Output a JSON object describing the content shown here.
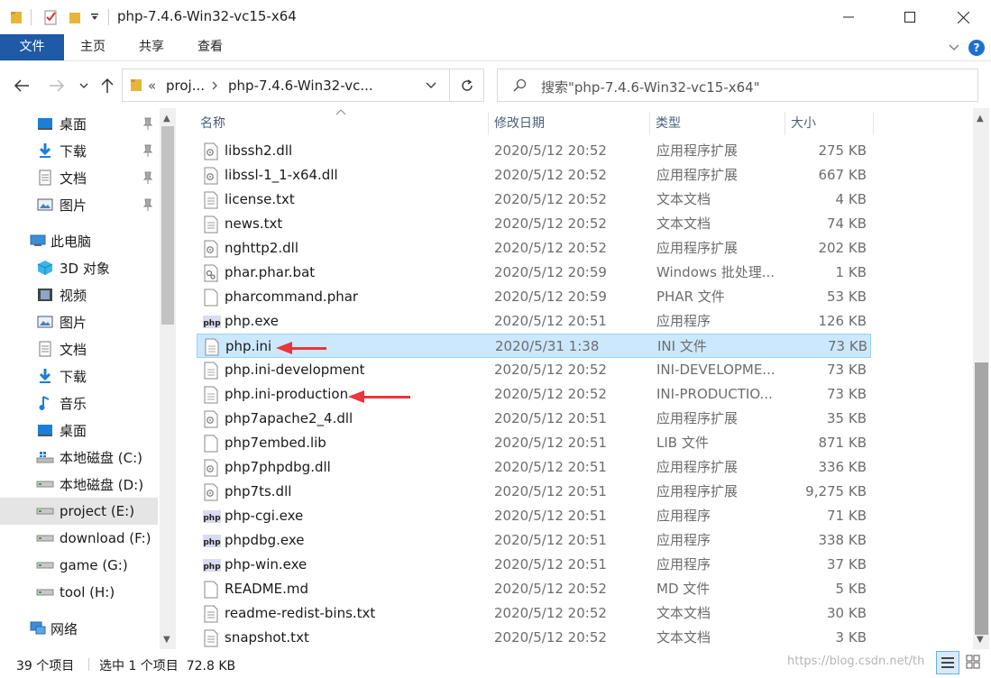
{
  "window": {
    "title": "php-7.4.6-Win32-vc15-x64"
  },
  "ribbon": {
    "tabs": [
      "文件",
      "主页",
      "共享",
      "查看"
    ]
  },
  "address": {
    "overflow": "«",
    "crumbs": [
      "proj...",
      "php-7.4.6-Win32-vc..."
    ]
  },
  "search": {
    "placeholder": "搜索\"php-7.4.6-Win32-vc15-x64\""
  },
  "sidebar": {
    "quick_access": [
      "桌面",
      "下载",
      "文档",
      "图片"
    ],
    "this_pc": "此电脑",
    "pc_items": [
      "3D 对象",
      "视频",
      "图片",
      "文档",
      "下载",
      "音乐",
      "桌面",
      "本地磁盘 (C:)",
      "本地磁盘 (D:)",
      "project (E:)",
      "download (F:)",
      "game (G:)",
      "tool (H:)"
    ],
    "network": "网络",
    "selected": "project (E:)"
  },
  "columns": [
    "名称",
    "修改日期",
    "类型",
    "大小"
  ],
  "files": [
    {
      "name": "libssh2.dll",
      "date": "2020/5/12 20:52",
      "type": "应用程序扩展",
      "size": "275 KB",
      "icon": "dll"
    },
    {
      "name": "libssl-1_1-x64.dll",
      "date": "2020/5/12 20:52",
      "type": "应用程序扩展",
      "size": "667 KB",
      "icon": "dll"
    },
    {
      "name": "license.txt",
      "date": "2020/5/12 20:52",
      "type": "文本文档",
      "size": "4 KB",
      "icon": "txt"
    },
    {
      "name": "news.txt",
      "date": "2020/5/12 20:52",
      "type": "文本文档",
      "size": "74 KB",
      "icon": "txt"
    },
    {
      "name": "nghttp2.dll",
      "date": "2020/5/12 20:52",
      "type": "应用程序扩展",
      "size": "202 KB",
      "icon": "dll"
    },
    {
      "name": "phar.phar.bat",
      "date": "2020/5/12 20:59",
      "type": "Windows 批处理...",
      "size": "1 KB",
      "icon": "bat"
    },
    {
      "name": "pharcommand.phar",
      "date": "2020/5/12 20:59",
      "type": "PHAR 文件",
      "size": "53 KB",
      "icon": "blank"
    },
    {
      "name": "php.exe",
      "date": "2020/5/12 20:51",
      "type": "应用程序",
      "size": "126 KB",
      "icon": "php"
    },
    {
      "name": "php.ini",
      "date": "2020/5/31 1:38",
      "type": "INI 文件",
      "size": "73 KB",
      "icon": "ini"
    },
    {
      "name": "php.ini-development",
      "date": "2020/5/12 20:52",
      "type": "INI-DEVELOPME...",
      "size": "73 KB",
      "icon": "ini"
    },
    {
      "name": "php.ini-production",
      "date": "2020/5/12 20:52",
      "type": "INI-PRODUCTIO...",
      "size": "73 KB",
      "icon": "ini"
    },
    {
      "name": "php7apache2_4.dll",
      "date": "2020/5/12 20:51",
      "type": "应用程序扩展",
      "size": "35 KB",
      "icon": "dll"
    },
    {
      "name": "php7embed.lib",
      "date": "2020/5/12 20:51",
      "type": "LIB 文件",
      "size": "871 KB",
      "icon": "blank"
    },
    {
      "name": "php7phpdbg.dll",
      "date": "2020/5/12 20:51",
      "type": "应用程序扩展",
      "size": "336 KB",
      "icon": "dll"
    },
    {
      "name": "php7ts.dll",
      "date": "2020/5/12 20:51",
      "type": "应用程序扩展",
      "size": "9,275 KB",
      "icon": "dll"
    },
    {
      "name": "php-cgi.exe",
      "date": "2020/5/12 20:51",
      "type": "应用程序",
      "size": "71 KB",
      "icon": "php"
    },
    {
      "name": "phpdbg.exe",
      "date": "2020/5/12 20:51",
      "type": "应用程序",
      "size": "338 KB",
      "icon": "php"
    },
    {
      "name": "php-win.exe",
      "date": "2020/5/12 20:51",
      "type": "应用程序",
      "size": "37 KB",
      "icon": "php"
    },
    {
      "name": "README.md",
      "date": "2020/5/12 20:52",
      "type": "MD 文件",
      "size": "5 KB",
      "icon": "blank"
    },
    {
      "name": "readme-redist-bins.txt",
      "date": "2020/5/12 20:52",
      "type": "文本文档",
      "size": "30 KB",
      "icon": "txt"
    },
    {
      "name": "snapshot.txt",
      "date": "2020/5/12 20:52",
      "type": "文本文档",
      "size": "3 KB",
      "icon": "txt"
    }
  ],
  "selected_file": "php.ini",
  "status": {
    "count": "39 个项目",
    "selection": "选中 1 个项目  72.8 KB"
  },
  "watermark": "https://blog.csdn.net/th",
  "colors": {
    "accent": "#1e5aa5",
    "selection": "#cce8ff",
    "annotation_arrow": "#e8363b"
  }
}
